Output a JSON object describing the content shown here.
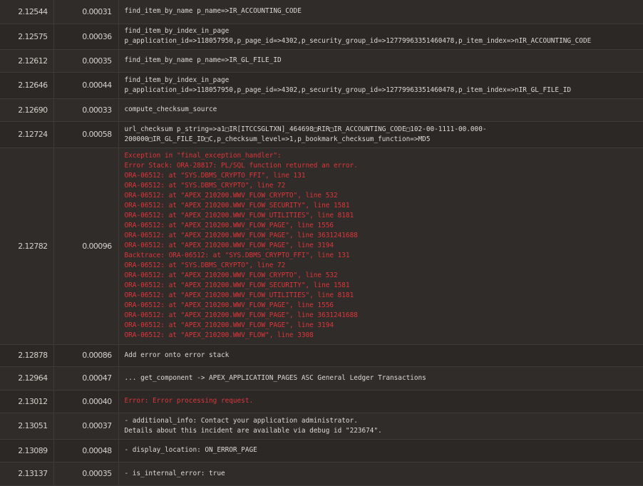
{
  "rows": [
    {
      "time": "2.12544",
      "elapsed": "0.00031",
      "error": false,
      "height": 33,
      "lines": [
        "find_item_by_name p_name=>IR_ACCOUNTING_CODE"
      ]
    },
    {
      "time": "2.12575",
      "elapsed": "0.00036",
      "error": false,
      "height": 36,
      "lines": [
        "find_item_by_index_in_page",
        "p_application_id=>118057950,p_page_id=>4302,p_security_group_id=>12779963351460478,p_item_index=>nIR_ACCOUNTING_CODE"
      ]
    },
    {
      "time": "2.12612",
      "elapsed": "0.00035",
      "error": false,
      "height": 32,
      "lines": [
        "find_item_by_name p_name=>IR_GL_FILE_ID"
      ]
    },
    {
      "time": "2.12646",
      "elapsed": "0.00044",
      "error": false,
      "height": 37,
      "lines": [
        "find_item_by_index_in_page",
        "p_application_id=>118057950,p_page_id=>4302,p_security_group_id=>12779963351460478,p_item_index=>nIR_GL_FILE_ID"
      ]
    },
    {
      "time": "2.12690",
      "elapsed": "0.00033",
      "error": false,
      "height": 32,
      "lines": [
        "compute_checksum_source"
      ]
    },
    {
      "time": "2.12724",
      "elapsed": "0.00058",
      "error": false,
      "height": 37,
      "lines": [
        "url_checksum p_string=>a1\u0000IR[ITCCSGLTXN]_464698\u0000RIR\u0000IR_ACCOUNTING_CODE\u0000102-00-1111-00.000-",
        "200000\u0000IR_GL_FILE_ID\u0000C,p_checksum_level=>1,p_bookmark_checksum_function=>MD5"
      ]
    },
    {
      "time": "2.12782",
      "elapsed": "0.00096",
      "error": true,
      "height": 276,
      "lines": [
        "Exception in \"final_exception_handler\":",
        "Error Stack: ORA-28817: PL/SQL function returned an error.",
        "ORA-06512: at \"SYS.DBMS_CRYPTO_FFI\", line 131",
        "ORA-06512: at \"SYS.DBMS_CRYPTO\", line 72",
        "ORA-06512: at \"APEX_210200.WWV_FLOW_CRYPTO\", line 532",
        "ORA-06512: at \"APEX_210200.WWV_FLOW_SECURITY\", line 1581",
        "ORA-06512: at \"APEX_210200.WWV_FLOW_UTILITIES\", line 8181",
        "ORA-06512: at \"APEX_210200.WWV_FLOW_PAGE\", line 1556",
        "ORA-06512: at \"APEX_210200.WWV_FLOW_PAGE\", line 3631241688",
        "ORA-06512: at \"APEX_210200.WWV_FLOW_PAGE\", line 3194",
        "Backtrace: ORA-06512: at \"SYS.DBMS_CRYPTO_FFI\", line 131",
        "ORA-06512: at \"SYS.DBMS_CRYPTO\", line 72",
        "ORA-06512: at \"APEX_210200.WWV_FLOW_CRYPTO\", line 532",
        "ORA-06512: at \"APEX_210200.WWV_FLOW_SECURITY\", line 1581",
        "ORA-06512: at \"APEX_210200.WWV_FLOW_UTILITIES\", line 8181",
        "ORA-06512: at \"APEX_210200.WWV_FLOW_PAGE\", line 1556",
        "ORA-06512: at \"APEX_210200.WWV_FLOW_PAGE\", line 3631241688",
        "ORA-06512: at \"APEX_210200.WWV_FLOW_PAGE\", line 3194",
        "ORA-06512: at \"APEX_210200.WWV_FLOW\", line 3308"
      ]
    },
    {
      "time": "2.12878",
      "elapsed": "0.00086",
      "error": false,
      "height": 31,
      "lines": [
        "Add error onto error stack"
      ]
    },
    {
      "time": "2.12964",
      "elapsed": "0.00047",
      "error": false,
      "height": 33,
      "lines": [
        "... get_component -> APEX_APPLICATION_PAGES ASC General Ledger Transactions"
      ]
    },
    {
      "time": "2.13012",
      "elapsed": "0.00040",
      "error": true,
      "height": 32,
      "lines": [
        "Error: Error processing request."
      ]
    },
    {
      "time": "2.13051",
      "elapsed": "0.00037",
      "error": false,
      "height": 37,
      "lines": [
        "- additional_info: Contact your application administrator.",
        "Details about this incident are available via debug id \"223674\"."
      ]
    },
    {
      "time": "2.13089",
      "elapsed": "0.00048",
      "error": false,
      "height": 32,
      "lines": [
        "- display_location: ON_ERROR_PAGE"
      ]
    },
    {
      "time": "2.13137",
      "elapsed": "0.00035",
      "error": false,
      "height": 33,
      "lines": [
        "- is_internal_error: true"
      ]
    }
  ]
}
